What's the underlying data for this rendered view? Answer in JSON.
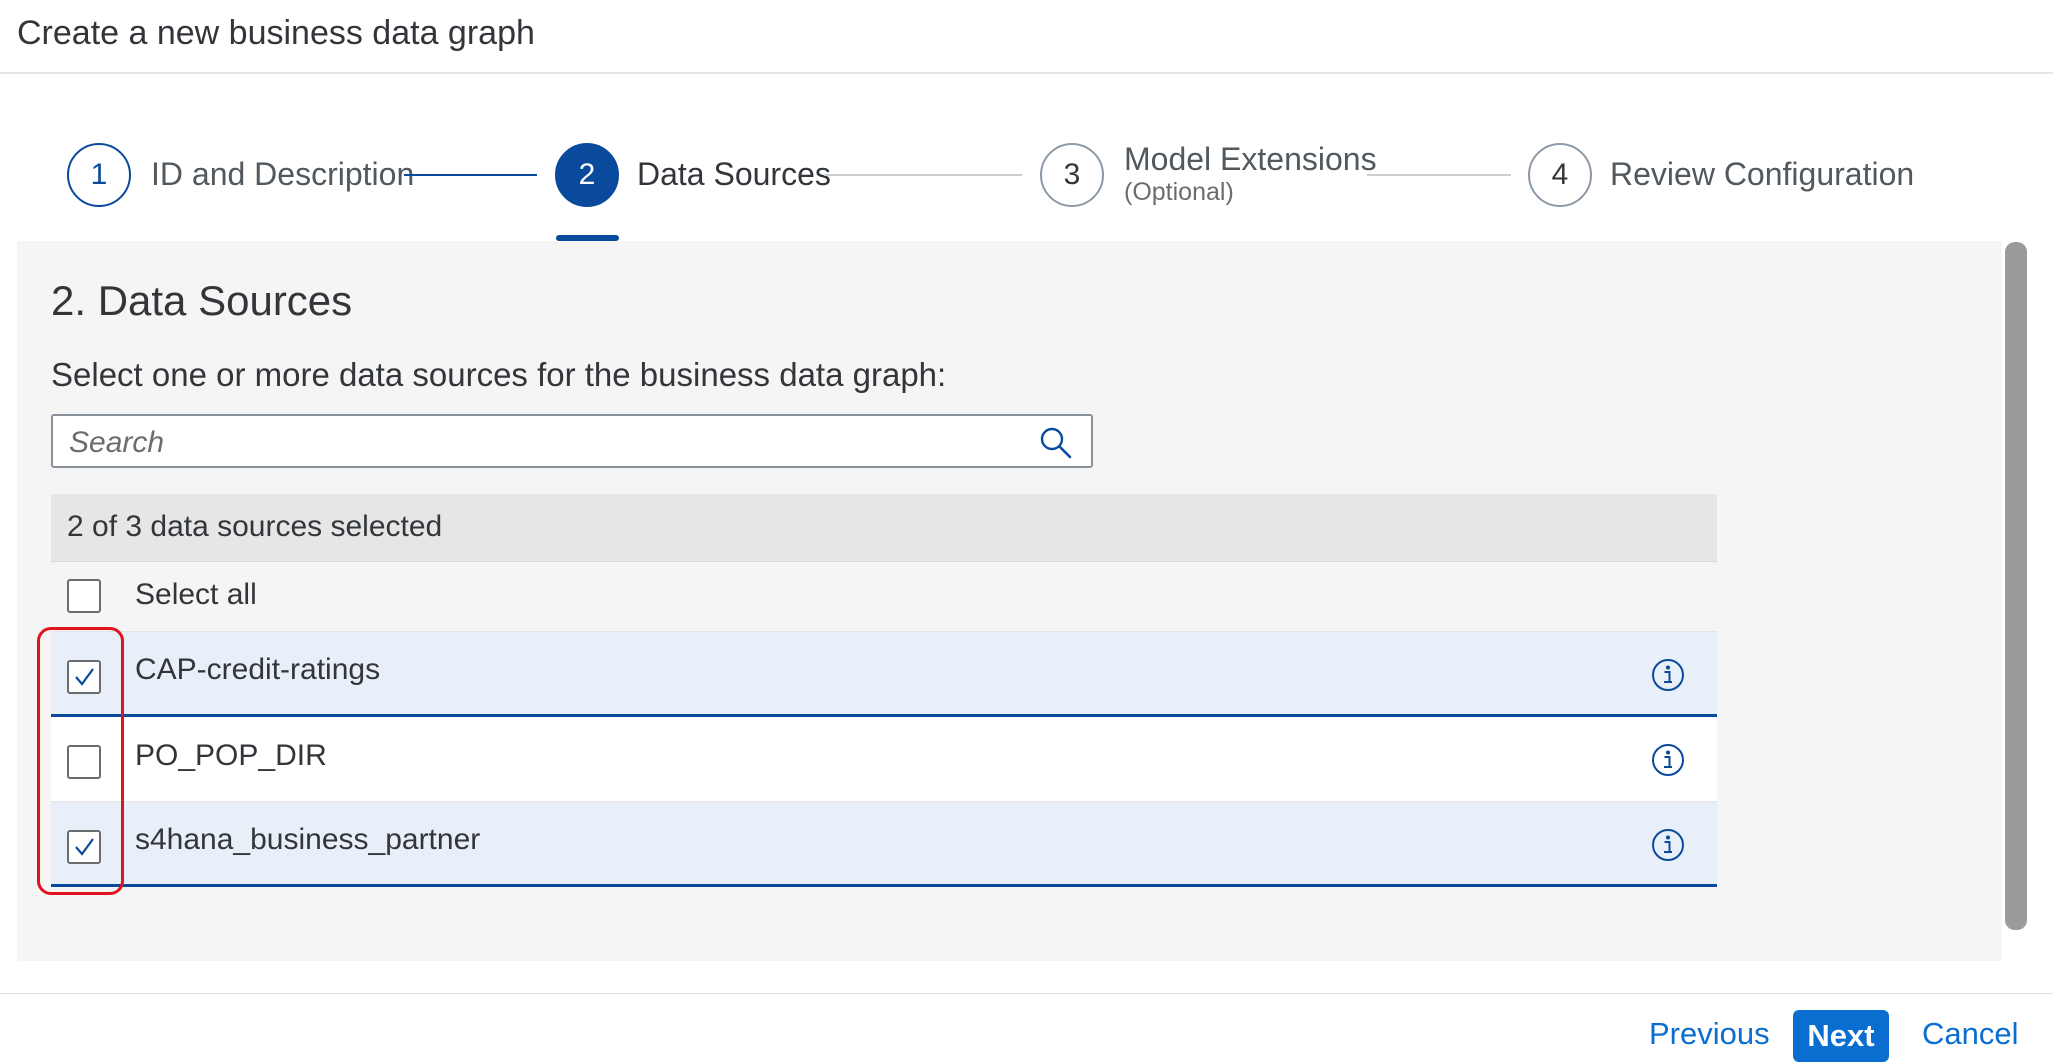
{
  "header": {
    "title": "Create a new business data graph"
  },
  "wizard": {
    "steps": [
      {
        "number": "1",
        "label": "ID and Description",
        "sublabel": ""
      },
      {
        "number": "2",
        "label": "Data Sources",
        "sublabel": ""
      },
      {
        "number": "3",
        "label": "Model Extensions",
        "sublabel": "(Optional)"
      },
      {
        "number": "4",
        "label": "Review Configuration",
        "sublabel": ""
      }
    ],
    "active_step": 2
  },
  "main": {
    "section_title": "2. Data Sources",
    "instruction": "Select one or more data sources for the business data graph:",
    "search": {
      "placeholder": "Search",
      "value": ""
    },
    "list": {
      "header": "2 of 3 data sources selected",
      "select_all_label": "Select all",
      "select_all_checked": false,
      "items": [
        {
          "label": "CAP-credit-ratings",
          "checked": true
        },
        {
          "label": "PO_POP_DIR",
          "checked": false
        },
        {
          "label": "s4hana_business_partner",
          "checked": true
        }
      ]
    }
  },
  "footer": {
    "previous_label": "Previous",
    "next_label": "Next",
    "cancel_label": "Cancel"
  },
  "colors": {
    "accent": "#0a4a9c",
    "button": "#0a6ed1",
    "highlight": "#e0141e"
  }
}
